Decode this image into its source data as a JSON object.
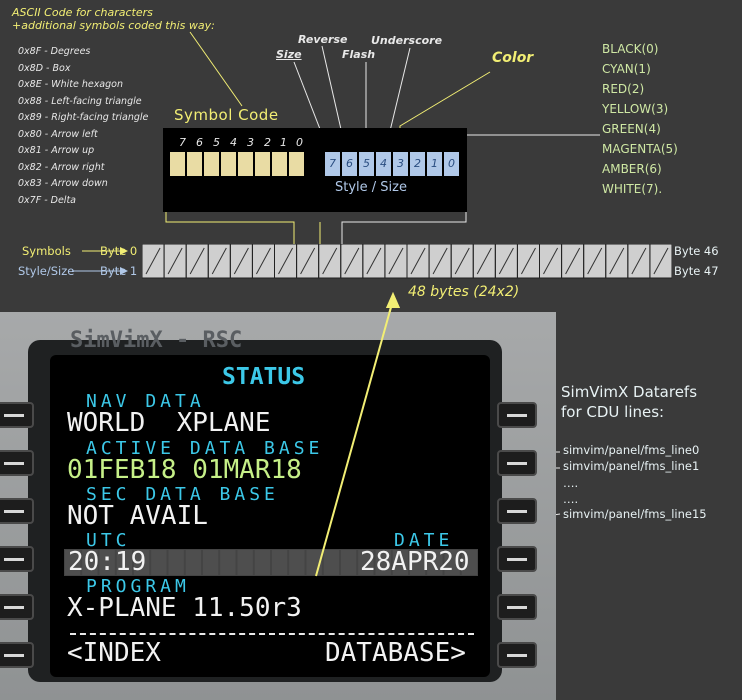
{
  "header_note": [
    "ASCII Code for characters",
    "+additional symbols coded this way:"
  ],
  "ascii_symbols": [
    "0x8F - Degrees",
    "0x8D - Box",
    "0x8E - White hexagon",
    "0x88 - Left-facing triangle",
    "0x89 - Right-facing triangle",
    "0x80 - Arrow left",
    "0x81 - Arrow up",
    "0x82 - Arrow right",
    "0x83 - Arrow down",
    "0x7F - Delta"
  ],
  "style_bits": {
    "reverse": "Reverse",
    "size": "Size",
    "flash": "Flash",
    "underscore": "Underscore",
    "color": "Color"
  },
  "color_codes": [
    "BLACK(0)",
    "CYAN(1)",
    "RED(2)",
    "YELLOW(3)",
    "GREEN(4)",
    "MAGENTA(5)",
    "AMBER(6)",
    "WHITE(7)."
  ],
  "symbol_code": {
    "title": "Symbol Code",
    "bits": [
      "7",
      "6",
      "5",
      "4",
      "3",
      "2",
      "1",
      "0"
    ]
  },
  "style_size": {
    "title": "Style / Size",
    "bits": [
      "7",
      "6",
      "5",
      "4",
      "3",
      "2",
      "1",
      "0"
    ]
  },
  "byte_row": {
    "symbols_label": "Symbols",
    "style_label": "Style/Size",
    "byte0": "Byte  0",
    "byte1": "Byte  1",
    "byte46": "Byte 46",
    "byte47": "Byte 47",
    "note": "48 bytes (24x2)"
  },
  "colors": {
    "yellow": "#f2ee74",
    "light_blue": "#b0c8e8",
    "symbol_fill": "#e9dca4",
    "green_text": "#cfe8a4",
    "cdu_cyan": "#3cc8e8",
    "cdu_green": "#c6f088",
    "cdu_white": "#f2f2f2"
  },
  "cdu": {
    "watermark": "SimVimX - RSC",
    "title": "STATUS",
    "nav_data_label": "NAV DATA",
    "nav_data_value": "WORLD  XPLANE",
    "active_db_label": "ACTIVE DATA BASE",
    "active_db_value": "01FEB18 01MAR18",
    "sec_db_label": "SEC DATA BASE",
    "sec_db_value": "NOT AVAIL",
    "utc_label": "UTC",
    "date_label": "DATE",
    "utc_value": "20:19",
    "date_value": "28APR20",
    "program_label": "PROGRAM",
    "program_value": "X-PLANE 11.50r3",
    "left_prompt": "<INDEX",
    "right_prompt": "DATABASE>"
  },
  "datarefs": {
    "title": [
      "SimVimX Datarefs",
      "for CDU lines:"
    ],
    "lines": [
      "simvim/panel/fms_line0",
      "simvim/panel/fms_line1",
      "….",
      "….",
      "simvim/panel/fms_line15"
    ]
  }
}
